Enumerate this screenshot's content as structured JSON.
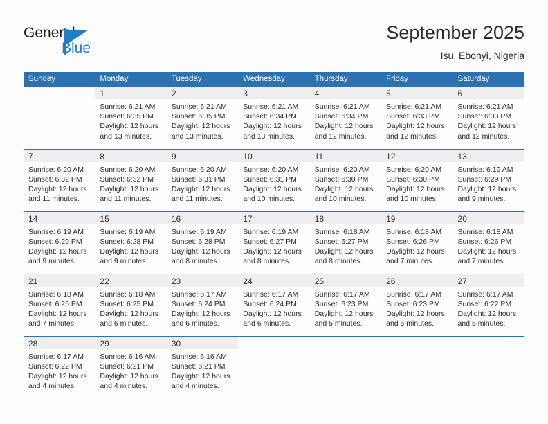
{
  "brand": {
    "name_top": "General",
    "name_bottom": "Blue",
    "logo_icon": "triangle-flag-icon",
    "accent_color": "#1f7dc4"
  },
  "header": {
    "title": "September 2025",
    "subtitle": "Isu, Ebonyi, Nigeria"
  },
  "theme": {
    "header_blue": "#2c72b3",
    "daynum_band": "#eeeeee",
    "text": "#2c2c2c"
  },
  "weekday_headers": [
    "Sunday",
    "Monday",
    "Tuesday",
    "Wednesday",
    "Thursday",
    "Friday",
    "Saturday"
  ],
  "weeks": [
    [
      {
        "day": "",
        "sunrise": "",
        "sunset": "",
        "daylight_line1": "",
        "daylight_line2": ""
      },
      {
        "day": "1",
        "sunrise": "Sunrise: 6:21 AM",
        "sunset": "Sunset: 6:35 PM",
        "daylight_line1": "Daylight: 12 hours",
        "daylight_line2": "and 13 minutes."
      },
      {
        "day": "2",
        "sunrise": "Sunrise: 6:21 AM",
        "sunset": "Sunset: 6:35 PM",
        "daylight_line1": "Daylight: 12 hours",
        "daylight_line2": "and 13 minutes."
      },
      {
        "day": "3",
        "sunrise": "Sunrise: 6:21 AM",
        "sunset": "Sunset: 6:34 PM",
        "daylight_line1": "Daylight: 12 hours",
        "daylight_line2": "and 13 minutes."
      },
      {
        "day": "4",
        "sunrise": "Sunrise: 6:21 AM",
        "sunset": "Sunset: 6:34 PM",
        "daylight_line1": "Daylight: 12 hours",
        "daylight_line2": "and 12 minutes."
      },
      {
        "day": "5",
        "sunrise": "Sunrise: 6:21 AM",
        "sunset": "Sunset: 6:33 PM",
        "daylight_line1": "Daylight: 12 hours",
        "daylight_line2": "and 12 minutes."
      },
      {
        "day": "6",
        "sunrise": "Sunrise: 6:21 AM",
        "sunset": "Sunset: 6:33 PM",
        "daylight_line1": "Daylight: 12 hours",
        "daylight_line2": "and 12 minutes."
      }
    ],
    [
      {
        "day": "7",
        "sunrise": "Sunrise: 6:20 AM",
        "sunset": "Sunset: 6:32 PM",
        "daylight_line1": "Daylight: 12 hours",
        "daylight_line2": "and 11 minutes."
      },
      {
        "day": "8",
        "sunrise": "Sunrise: 6:20 AM",
        "sunset": "Sunset: 6:32 PM",
        "daylight_line1": "Daylight: 12 hours",
        "daylight_line2": "and 11 minutes."
      },
      {
        "day": "9",
        "sunrise": "Sunrise: 6:20 AM",
        "sunset": "Sunset: 6:31 PM",
        "daylight_line1": "Daylight: 12 hours",
        "daylight_line2": "and 11 minutes."
      },
      {
        "day": "10",
        "sunrise": "Sunrise: 6:20 AM",
        "sunset": "Sunset: 6:31 PM",
        "daylight_line1": "Daylight: 12 hours",
        "daylight_line2": "and 10 minutes."
      },
      {
        "day": "11",
        "sunrise": "Sunrise: 6:20 AM",
        "sunset": "Sunset: 6:30 PM",
        "daylight_line1": "Daylight: 12 hours",
        "daylight_line2": "and 10 minutes."
      },
      {
        "day": "12",
        "sunrise": "Sunrise: 6:20 AM",
        "sunset": "Sunset: 6:30 PM",
        "daylight_line1": "Daylight: 12 hours",
        "daylight_line2": "and 10 minutes."
      },
      {
        "day": "13",
        "sunrise": "Sunrise: 6:19 AM",
        "sunset": "Sunset: 6:29 PM",
        "daylight_line1": "Daylight: 12 hours",
        "daylight_line2": "and 9 minutes."
      }
    ],
    [
      {
        "day": "14",
        "sunrise": "Sunrise: 6:19 AM",
        "sunset": "Sunset: 6:29 PM",
        "daylight_line1": "Daylight: 12 hours",
        "daylight_line2": "and 9 minutes."
      },
      {
        "day": "15",
        "sunrise": "Sunrise: 6:19 AM",
        "sunset": "Sunset: 6:28 PM",
        "daylight_line1": "Daylight: 12 hours",
        "daylight_line2": "and 9 minutes."
      },
      {
        "day": "16",
        "sunrise": "Sunrise: 6:19 AM",
        "sunset": "Sunset: 6:28 PM",
        "daylight_line1": "Daylight: 12 hours",
        "daylight_line2": "and 8 minutes."
      },
      {
        "day": "17",
        "sunrise": "Sunrise: 6:19 AM",
        "sunset": "Sunset: 6:27 PM",
        "daylight_line1": "Daylight: 12 hours",
        "daylight_line2": "and 8 minutes."
      },
      {
        "day": "18",
        "sunrise": "Sunrise: 6:18 AM",
        "sunset": "Sunset: 6:27 PM",
        "daylight_line1": "Daylight: 12 hours",
        "daylight_line2": "and 8 minutes."
      },
      {
        "day": "19",
        "sunrise": "Sunrise: 6:18 AM",
        "sunset": "Sunset: 6:26 PM",
        "daylight_line1": "Daylight: 12 hours",
        "daylight_line2": "and 7 minutes."
      },
      {
        "day": "20",
        "sunrise": "Sunrise: 6:18 AM",
        "sunset": "Sunset: 6:26 PM",
        "daylight_line1": "Daylight: 12 hours",
        "daylight_line2": "and 7 minutes."
      }
    ],
    [
      {
        "day": "21",
        "sunrise": "Sunrise: 6:18 AM",
        "sunset": "Sunset: 6:25 PM",
        "daylight_line1": "Daylight: 12 hours",
        "daylight_line2": "and 7 minutes."
      },
      {
        "day": "22",
        "sunrise": "Sunrise: 6:18 AM",
        "sunset": "Sunset: 6:25 PM",
        "daylight_line1": "Daylight: 12 hours",
        "daylight_line2": "and 6 minutes."
      },
      {
        "day": "23",
        "sunrise": "Sunrise: 6:17 AM",
        "sunset": "Sunset: 6:24 PM",
        "daylight_line1": "Daylight: 12 hours",
        "daylight_line2": "and 6 minutes."
      },
      {
        "day": "24",
        "sunrise": "Sunrise: 6:17 AM",
        "sunset": "Sunset: 6:24 PM",
        "daylight_line1": "Daylight: 12 hours",
        "daylight_line2": "and 6 minutes."
      },
      {
        "day": "25",
        "sunrise": "Sunrise: 6:17 AM",
        "sunset": "Sunset: 6:23 PM",
        "daylight_line1": "Daylight: 12 hours",
        "daylight_line2": "and 5 minutes."
      },
      {
        "day": "26",
        "sunrise": "Sunrise: 6:17 AM",
        "sunset": "Sunset: 6:23 PM",
        "daylight_line1": "Daylight: 12 hours",
        "daylight_line2": "and 5 minutes."
      },
      {
        "day": "27",
        "sunrise": "Sunrise: 6:17 AM",
        "sunset": "Sunset: 6:22 PM",
        "daylight_line1": "Daylight: 12 hours",
        "daylight_line2": "and 5 minutes."
      }
    ],
    [
      {
        "day": "28",
        "sunrise": "Sunrise: 6:17 AM",
        "sunset": "Sunset: 6:22 PM",
        "daylight_line1": "Daylight: 12 hours",
        "daylight_line2": "and 4 minutes."
      },
      {
        "day": "29",
        "sunrise": "Sunrise: 6:16 AM",
        "sunset": "Sunset: 6:21 PM",
        "daylight_line1": "Daylight: 12 hours",
        "daylight_line2": "and 4 minutes."
      },
      {
        "day": "30",
        "sunrise": "Sunrise: 6:16 AM",
        "sunset": "Sunset: 6:21 PM",
        "daylight_line1": "Daylight: 12 hours",
        "daylight_line2": "and 4 minutes."
      },
      {
        "day": "",
        "sunrise": "",
        "sunset": "",
        "daylight_line1": "",
        "daylight_line2": ""
      },
      {
        "day": "",
        "sunrise": "",
        "sunset": "",
        "daylight_line1": "",
        "daylight_line2": ""
      },
      {
        "day": "",
        "sunrise": "",
        "sunset": "",
        "daylight_line1": "",
        "daylight_line2": ""
      },
      {
        "day": "",
        "sunrise": "",
        "sunset": "",
        "daylight_line1": "",
        "daylight_line2": ""
      }
    ]
  ]
}
